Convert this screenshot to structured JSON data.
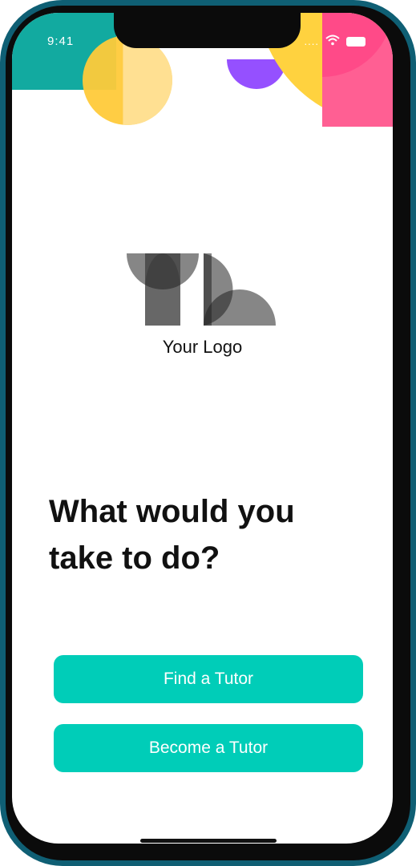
{
  "status_bar": {
    "time": "9:41",
    "signal_text": "....",
    "icons": [
      "signal-icon",
      "wifi-icon",
      "battery-icon"
    ]
  },
  "brand": {
    "logo_text": "Your Logo"
  },
  "onboarding": {
    "headline_line1": "What would you",
    "headline_line2": "take to do?",
    "primary_button": "Find a Tutor",
    "secondary_button": "Become a Tutor"
  },
  "colors": {
    "device_frame": "#0f5f74",
    "accent_teal": "#00cdb8",
    "header_teal": "#12aaa0",
    "header_yellow": "#ffca3a",
    "header_purple": "#8a3dff",
    "header_pink": "#ff5f93"
  }
}
